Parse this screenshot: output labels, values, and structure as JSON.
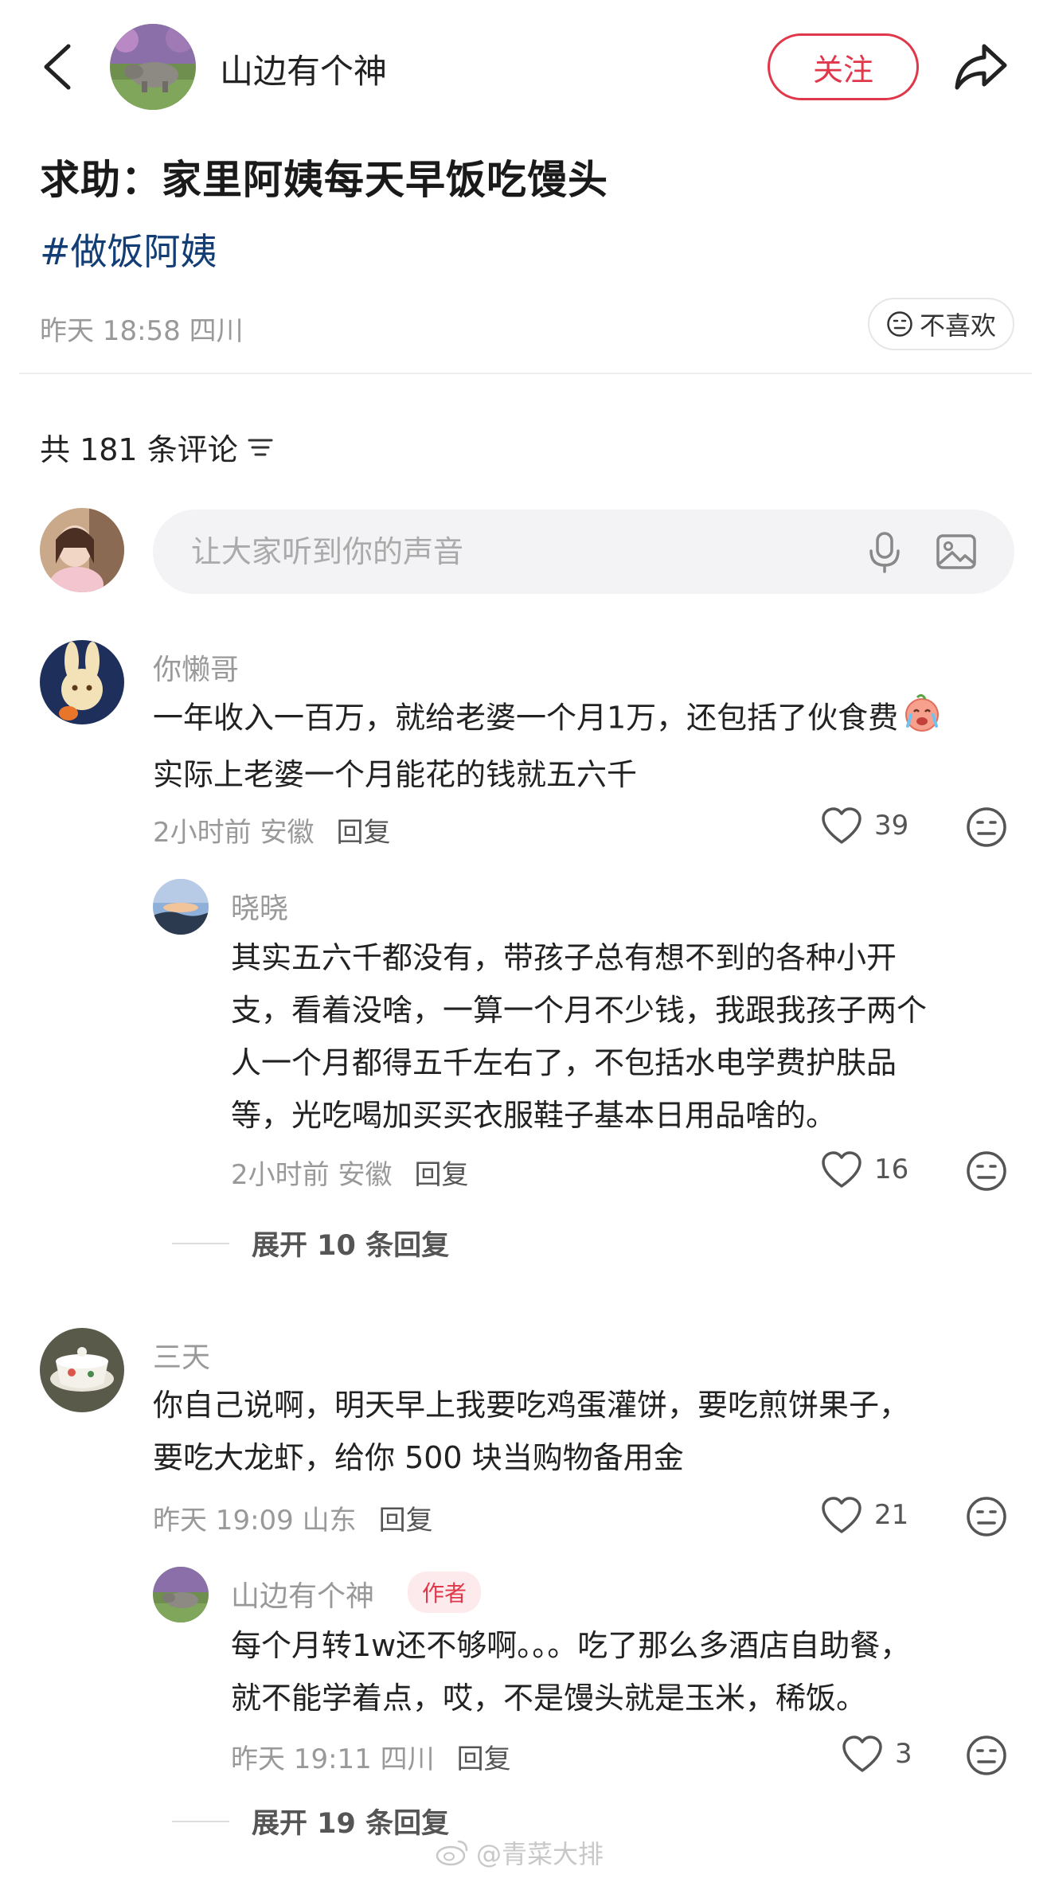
{
  "header": {
    "author_name": "山边有个神",
    "follow_label": "关注"
  },
  "post": {
    "title": "求助：家里阿姨每天早饭吃馒头",
    "tag": "#做饭阿姨",
    "meta": "昨天 18:58 四川",
    "dislike_label": "不喜欢"
  },
  "comments_section": {
    "count_label": "共 181 条评论",
    "input_placeholder": "让大家听到你的声音"
  },
  "comments": [
    {
      "name": "你懒哥",
      "lines": [
        "一年收入一百万，就给老婆一个月1万，还包括了伙食费",
        "实际上老婆一个月能花的钱就五六千"
      ],
      "meta": "2小时前  安徽",
      "reply_label": "回复",
      "likes": "39",
      "replies": [
        {
          "name": "晓晓",
          "lines": [
            "其实五六千都没有，带孩子总有想不到的各种小开",
            "支，看着没啥，一算一个月不少钱，我跟我孩子两个",
            "人一个月都得五千左右了，不包括水电学费护肤品",
            "等，光吃喝加买买衣服鞋子基本日用品啥的。"
          ],
          "meta": "2小时前  安徽",
          "reply_label": "回复",
          "likes": "16"
        }
      ],
      "expand_label": "展开 10 条回复"
    },
    {
      "name": "三天",
      "lines": [
        "你自己说啊，明天早上我要吃鸡蛋灌饼，要吃煎饼果子，",
        "要吃大龙虾，给你 500 块当购物备用金"
      ],
      "meta": "昨天 19:09 山东",
      "reply_label": "回复",
      "likes": "21",
      "replies": [
        {
          "name": "山边有个神",
          "badge": "作者",
          "lines": [
            "每个月转1w还不够啊。。。吃了那么多酒店自助餐，",
            "就不能学着点，哎，不是馒头就是玉米，稀饭。"
          ],
          "meta": "昨天 19:11 四川",
          "reply_label": "回复",
          "likes": "3"
        }
      ],
      "expand_label": "展开 19 条回复"
    }
  ],
  "watermark": "@青菜大排",
  "colors": {
    "accent": "#e0384b",
    "tag": "#133d75",
    "muted": "#999999"
  },
  "icons": [
    "back-icon",
    "share-icon",
    "meh-face-icon",
    "sort-icon",
    "mic-icon",
    "image-icon",
    "heart-icon",
    "cry-emoji-icon",
    "weibo-icon"
  ]
}
